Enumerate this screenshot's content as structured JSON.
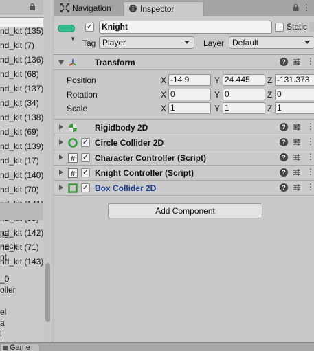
{
  "hierarchy": {
    "rows": [
      "nd_kit (135)",
      "nd_kit (7)",
      "nd_kit (136)",
      "nd_kit (68)",
      "nd_kit (137)",
      "nd_kit (34)",
      "nd_kit (138)",
      "nd_kit (69)",
      "nd_kit (139)",
      "nd_kit (17)",
      "nd_kit (140)",
      "nd_kit (70)",
      "nd_kit (141)",
      "nd_kit (35)",
      "nd_kit (142)",
      "nd_kit (71)",
      "nd_kit (143)"
    ],
    "rows_below": [
      "ite",
      "neck",
      "nt",
      "",
      "_0",
      "oller",
      "",
      "el",
      "a",
      "l"
    ]
  },
  "bottom": {
    "game_tab": "Game"
  },
  "tabs": {
    "navigation": "Navigation",
    "inspector": "Inspector"
  },
  "object": {
    "name": "Knight",
    "static_label": "Static",
    "tag_label": "Tag",
    "tag_value": "Player",
    "layer_label": "Layer",
    "layer_value": "Default"
  },
  "transform": {
    "title": "Transform",
    "rows": [
      {
        "label": "Position",
        "x": "-14.9",
        "y": "24.445",
        "z": "-131.373"
      },
      {
        "label": "Rotation",
        "x": "0",
        "y": "0",
        "z": "0"
      },
      {
        "label": "Scale",
        "x": "1",
        "y": "1",
        "z": "1"
      }
    ],
    "axes": {
      "x": "X",
      "y": "Y",
      "z": "Z"
    }
  },
  "components": [
    {
      "title": "Rigidbody 2D",
      "icon": "rigidbody-icon"
    },
    {
      "title": "Circle Collider 2D",
      "icon": "circle-collider-icon"
    },
    {
      "title": "Character Controller (Script)",
      "icon": "script-icon"
    },
    {
      "title": "Knight Controller (Script)",
      "icon": "script-icon"
    },
    {
      "title": "Box Collider 2D",
      "icon": "box-collider-icon"
    }
  ],
  "add_component": "Add Component",
  "colors": {
    "accent_green": "#34b98a",
    "selected_blue": "#1c3f8f"
  }
}
